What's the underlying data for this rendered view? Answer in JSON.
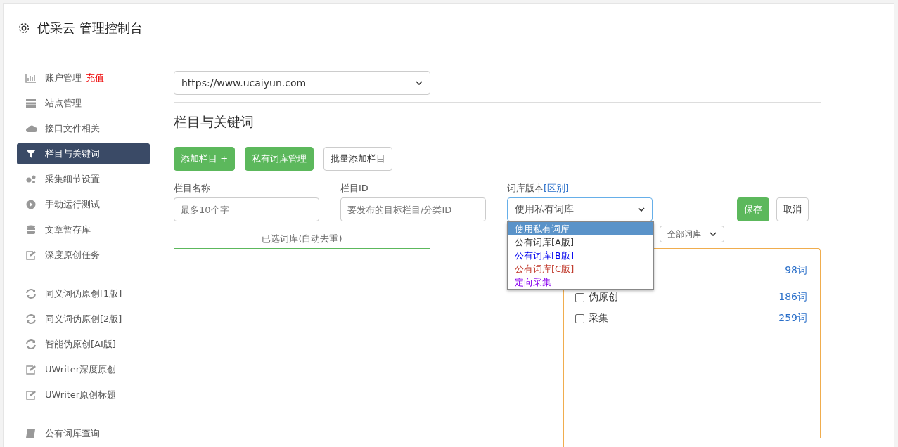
{
  "header": {
    "title": "优采云 管理控制台"
  },
  "sidebar": {
    "groups": [
      {
        "items": [
          {
            "label": "账户管理",
            "badge": "充值",
            "selected": false
          },
          {
            "label": "站点管理",
            "selected": false
          },
          {
            "label": "接口文件相关",
            "selected": false
          },
          {
            "label": "栏目与关键词",
            "selected": true
          },
          {
            "label": "采集细节设置",
            "selected": false
          },
          {
            "label": "手动运行测试",
            "selected": false
          },
          {
            "label": "文章暂存库",
            "selected": false
          },
          {
            "label": "深度原创任务",
            "selected": false
          }
        ]
      },
      {
        "items": [
          {
            "label": "同义词伪原创[1版]",
            "selected": false
          },
          {
            "label": "同义词伪原创[2版]",
            "selected": false
          },
          {
            "label": "智能伪原创[AI版]",
            "selected": false
          },
          {
            "label": "UWriter深度原创",
            "selected": false
          },
          {
            "label": "UWriter原创标题",
            "selected": false
          }
        ]
      },
      {
        "items": [
          {
            "label": "公有词库查询",
            "selected": false
          }
        ]
      }
    ]
  },
  "site_select": {
    "value": "https://www.ucaiyun.com"
  },
  "section_title": "栏目与关键词",
  "actions": [
    {
      "label": "添加栏目 +",
      "kind": "primary"
    },
    {
      "label": "私有词库管理",
      "kind": "primary"
    },
    {
      "label": "批量添加栏目",
      "kind": "default"
    }
  ],
  "form": {
    "name_label": "栏目名称",
    "name_placeholder": "最多10个字",
    "id_label": "栏目ID",
    "id_placeholder": "要发布的目标栏目/分类ID",
    "version_label": "词库版本",
    "version_link": "[区别]",
    "version_value": "使用私有词库",
    "version_options": [
      {
        "label": "使用私有词库",
        "selected": true
      },
      {
        "label": "公有词库[A版]",
        "selected": false,
        "color": "#333333"
      },
      {
        "label": "公有词库[B版]",
        "selected": false,
        "color": "#0000ee"
      },
      {
        "label": "公有词库[C版]",
        "selected": false,
        "color": "#c0392b"
      },
      {
        "label": "定向采集",
        "selected": false,
        "color": "#8800ee"
      }
    ],
    "save": "保存",
    "cancel": "取消"
  },
  "selected_title": "已选词库(自动去重)",
  "library_filter": "全部词库",
  "libraries": [
    {
      "count": "98词"
    },
    {
      "label": "伪原创",
      "count": "186词",
      "checked": false
    },
    {
      "label": "采集",
      "count": "259词",
      "checked": false
    }
  ]
}
